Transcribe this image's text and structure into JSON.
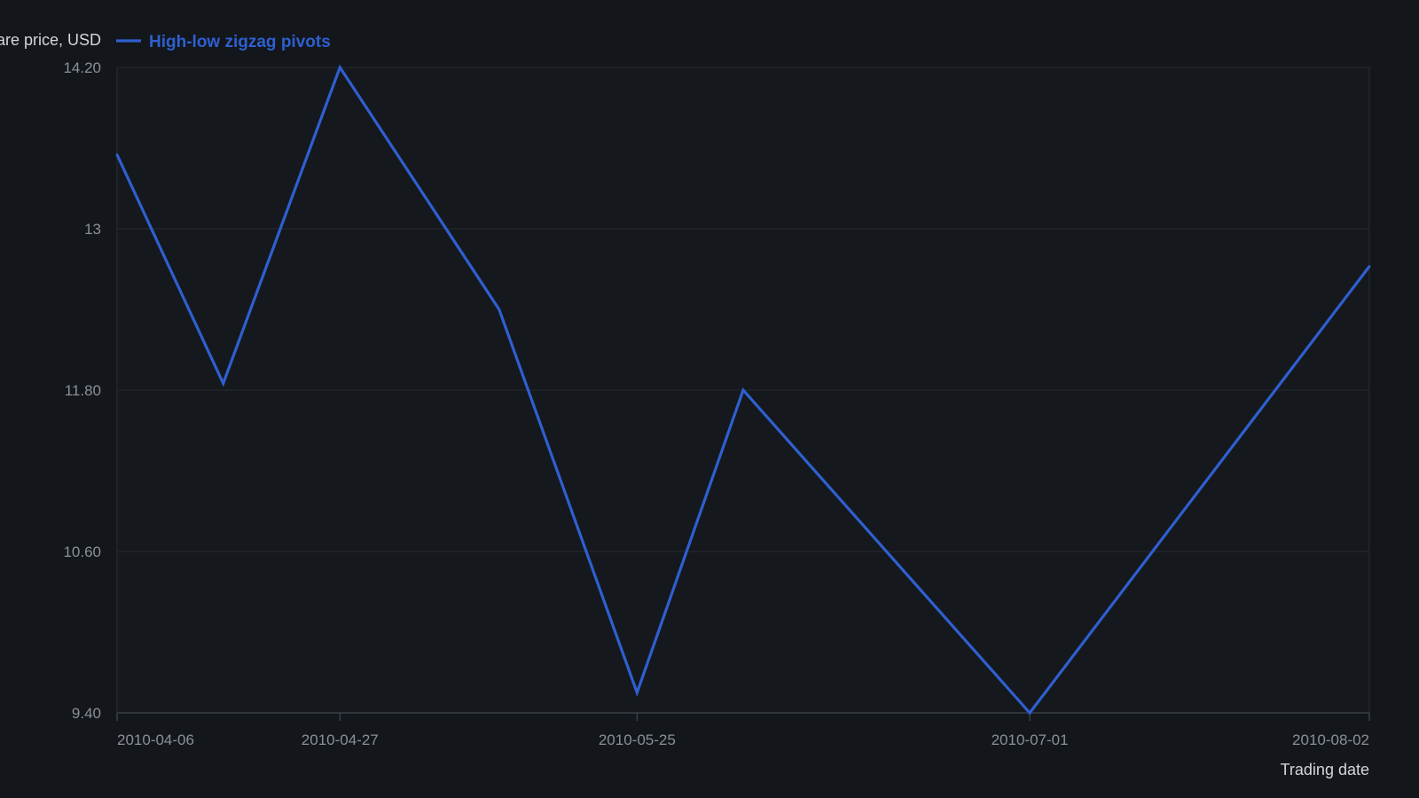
{
  "chart_data": {
    "type": "line",
    "title": "",
    "xlabel": "Trading date",
    "ylabel": "Share price, USD",
    "x_type": "date",
    "xlim": [
      "2010-04-06",
      "2010-08-02"
    ],
    "ylim": [
      9.4,
      14.2
    ],
    "x_ticks": [
      "2010-04-06",
      "2010-04-27",
      "2010-05-25",
      "2010-07-01",
      "2010-08-02"
    ],
    "y_ticks": [
      {
        "value": 9.4,
        "label": "9.40"
      },
      {
        "value": 10.6,
        "label": "10.60"
      },
      {
        "value": 11.8,
        "label": "11.80"
      },
      {
        "value": 13.0,
        "label": "13"
      },
      {
        "value": 14.2,
        "label": "14.20"
      }
    ],
    "grid": true,
    "legend": "top-left",
    "series": [
      {
        "name": "High-low zigzag pivots",
        "color": "#2f5fd0",
        "x": [
          "2010-04-06",
          "2010-04-16",
          "2010-04-27",
          "2010-05-12",
          "2010-05-25",
          "2010-06-04",
          "2010-07-01",
          "2010-08-02"
        ],
        "y": [
          13.55,
          11.85,
          14.2,
          12.4,
          9.55,
          11.8,
          9.4,
          12.72
        ]
      }
    ]
  },
  "colors": {
    "background": "#13161b",
    "plot_background": "#15181d",
    "grid": "#262a31",
    "axis": "#3a3e46"
  }
}
